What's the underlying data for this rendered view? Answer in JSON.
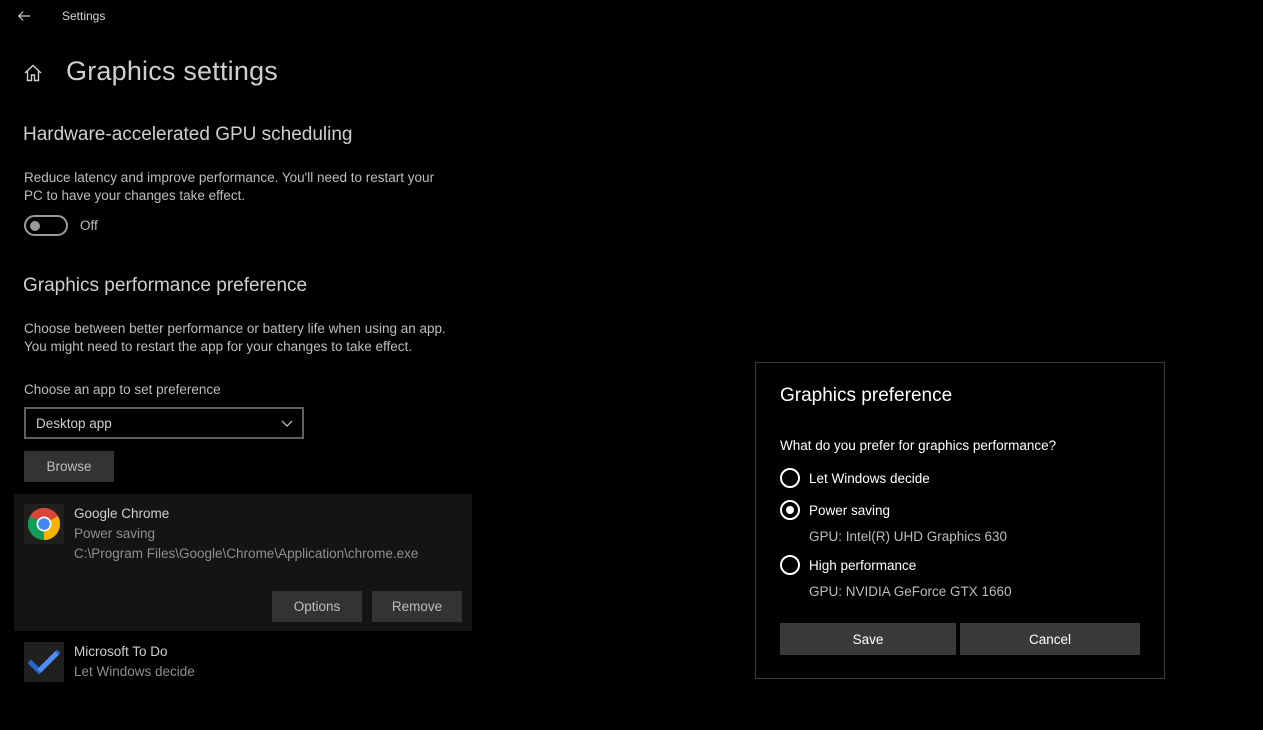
{
  "window": {
    "title": "Settings"
  },
  "page": {
    "title": "Graphics settings"
  },
  "gpu_scheduling": {
    "heading": "Hardware-accelerated GPU scheduling",
    "description_line1": "Reduce latency and improve performance. You'll need to restart your",
    "description_line2": "PC to have your changes take effect.",
    "toggle_state": "Off"
  },
  "performance_pref": {
    "heading": "Graphics performance preference",
    "description_line1": "Choose between better performance or battery life when using an app.",
    "description_line2": "You might need to restart the app for your changes to take effect.",
    "choose_label": "Choose an app to set preference",
    "selected_app_type": "Desktop app",
    "browse_label": "Browse"
  },
  "apps": [
    {
      "name": "Google Chrome",
      "preference": "Power saving",
      "path": "C:\\Program Files\\Google\\Chrome\\Application\\chrome.exe",
      "icon": "chrome-icon",
      "options_label": "Options",
      "remove_label": "Remove"
    },
    {
      "name": "Microsoft To Do",
      "preference": "Let Windows decide",
      "icon": "todo-icon"
    }
  ],
  "dialog": {
    "title": "Graphics preference",
    "question": "What do you prefer for graphics performance?",
    "options": [
      {
        "label": "Let Windows decide",
        "selected": false
      },
      {
        "label": "Power saving",
        "selected": true,
        "gpu": "GPU: Intel(R) UHD Graphics 630"
      },
      {
        "label": "High performance",
        "selected": false,
        "gpu": "GPU: NVIDIA GeForce GTX 1660"
      }
    ],
    "save_label": "Save",
    "cancel_label": "Cancel"
  },
  "colors": {
    "background": "#000000",
    "button": "#333333",
    "selected_row": "#141414",
    "chrome_red": "#DB4437",
    "chrome_yellow": "#F4B400",
    "chrome_green": "#0F9D58",
    "chrome_blue": "#4285F4",
    "todo_blue": "#2564CF"
  }
}
